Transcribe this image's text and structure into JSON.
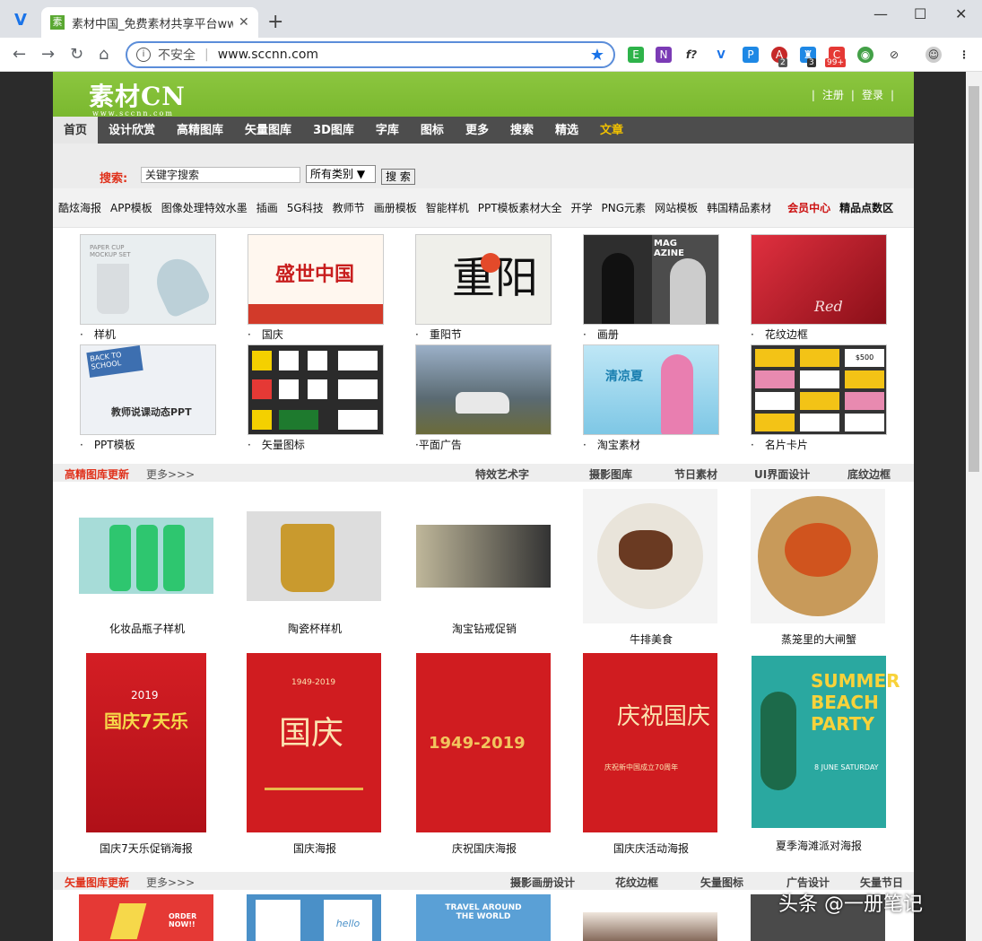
{
  "browser": {
    "tab_title": "素材中国_免费素材共享平台www",
    "insecure_label": "不安全",
    "url": "www.sccnn.com",
    "ext_badges": [
      "2",
      "3",
      "99+"
    ]
  },
  "header": {
    "logo": "素材CN",
    "logo_sub": "www.sccnn.com",
    "register": "注册",
    "login": "登录"
  },
  "nav": [
    "首页",
    "设计欣赏",
    "高精图库",
    "矢量图库",
    "3D图库",
    "字库",
    "图标",
    "更多",
    "搜索",
    "精选",
    "文章"
  ],
  "search": {
    "label": "搜索:",
    "placeholder": "关键字搜索",
    "category": "所有类别",
    "button": "搜 索"
  },
  "categories": [
    "酷炫海报",
    "APP模板",
    "图像处理特效水墨",
    "插画",
    "5G科技",
    "教师节",
    "画册模板",
    "智能样机",
    "PPT模板素材大全",
    "开学",
    "PNG元素",
    "网站模板",
    "韩国精品素材"
  ],
  "member_center": "会员中心",
  "featured_count": "精品点数区",
  "top_grid": [
    {
      "caption": "·　样机",
      "color": "#e9eef0"
    },
    {
      "caption": "·　国庆",
      "color": "#d23a2a"
    },
    {
      "caption": "·　重阳节",
      "color": "#efefea"
    },
    {
      "caption": "·　画册",
      "color": "#5d5d5d"
    },
    {
      "caption": "·　花纹边框",
      "color": "#b0121e"
    },
    {
      "caption": "·　PPT模板",
      "color": "#eaedf2"
    },
    {
      "caption": "·　矢量图标",
      "color": "#2b2b2b"
    },
    {
      "caption": "·平面广告",
      "color": "#9bb0c8"
    },
    {
      "caption": "·　淘宝素材",
      "color": "#9fd7ee"
    },
    {
      "caption": "·　名片卡片",
      "color": "#333333"
    }
  ],
  "thumb_text": {
    "mockup": "PAPER CUP MOCKUP SET",
    "guoqing": "盛世中国",
    "chongyang": "重阳",
    "mag": "MAG AZINE",
    "red": "Red",
    "ppt": "教师说课动态PPT",
    "ppt_top": "BACK TO SCHOOL",
    "taobao": "清凉夏",
    "card": "$500"
  },
  "section1": {
    "title": "高精图库更新",
    "more": "更多>>>",
    "tags": [
      "特效艺术字",
      "摄影图库",
      "节日素材",
      "UI界面设计",
      "底纹边框"
    ]
  },
  "products1": [
    {
      "caption": "化妆品瓶子样机"
    },
    {
      "caption": "陶瓷杯样机"
    },
    {
      "caption": "淘宝钻戒促销"
    },
    {
      "caption": "牛排美食"
    },
    {
      "caption": "蒸笼里的大闸蟹"
    }
  ],
  "posters": [
    {
      "caption": "国庆7天乐促销海报",
      "text": "国庆7天乐"
    },
    {
      "caption": "国庆海报",
      "text": "国庆"
    },
    {
      "caption": "庆祝国庆海报",
      "text": "1949-2019"
    },
    {
      "caption": "国庆庆活动海报",
      "text": "庆祝国庆"
    },
    {
      "caption": "夏季海滩派对海报",
      "text": "SUMMER BEACH PARTY"
    }
  ],
  "poster_subtext": {
    "p1": "2019",
    "p2": "1949-2019",
    "p4": "庆祝新中国成立70周年",
    "p5": "8 JUNE SATURDAY"
  },
  "section2": {
    "title": "矢量图库更新",
    "more": "更多>>>",
    "tags": [
      "摄影画册设计",
      "花纹边框",
      "矢量图标",
      "广告设计",
      "矢量节日"
    ]
  },
  "bottom_text": {
    "order": "ORDER NOW!!",
    "travel": "TRAVEL AROUND THE WORLD",
    "hello": "hello"
  },
  "watermark": "头条 @一册笔记"
}
